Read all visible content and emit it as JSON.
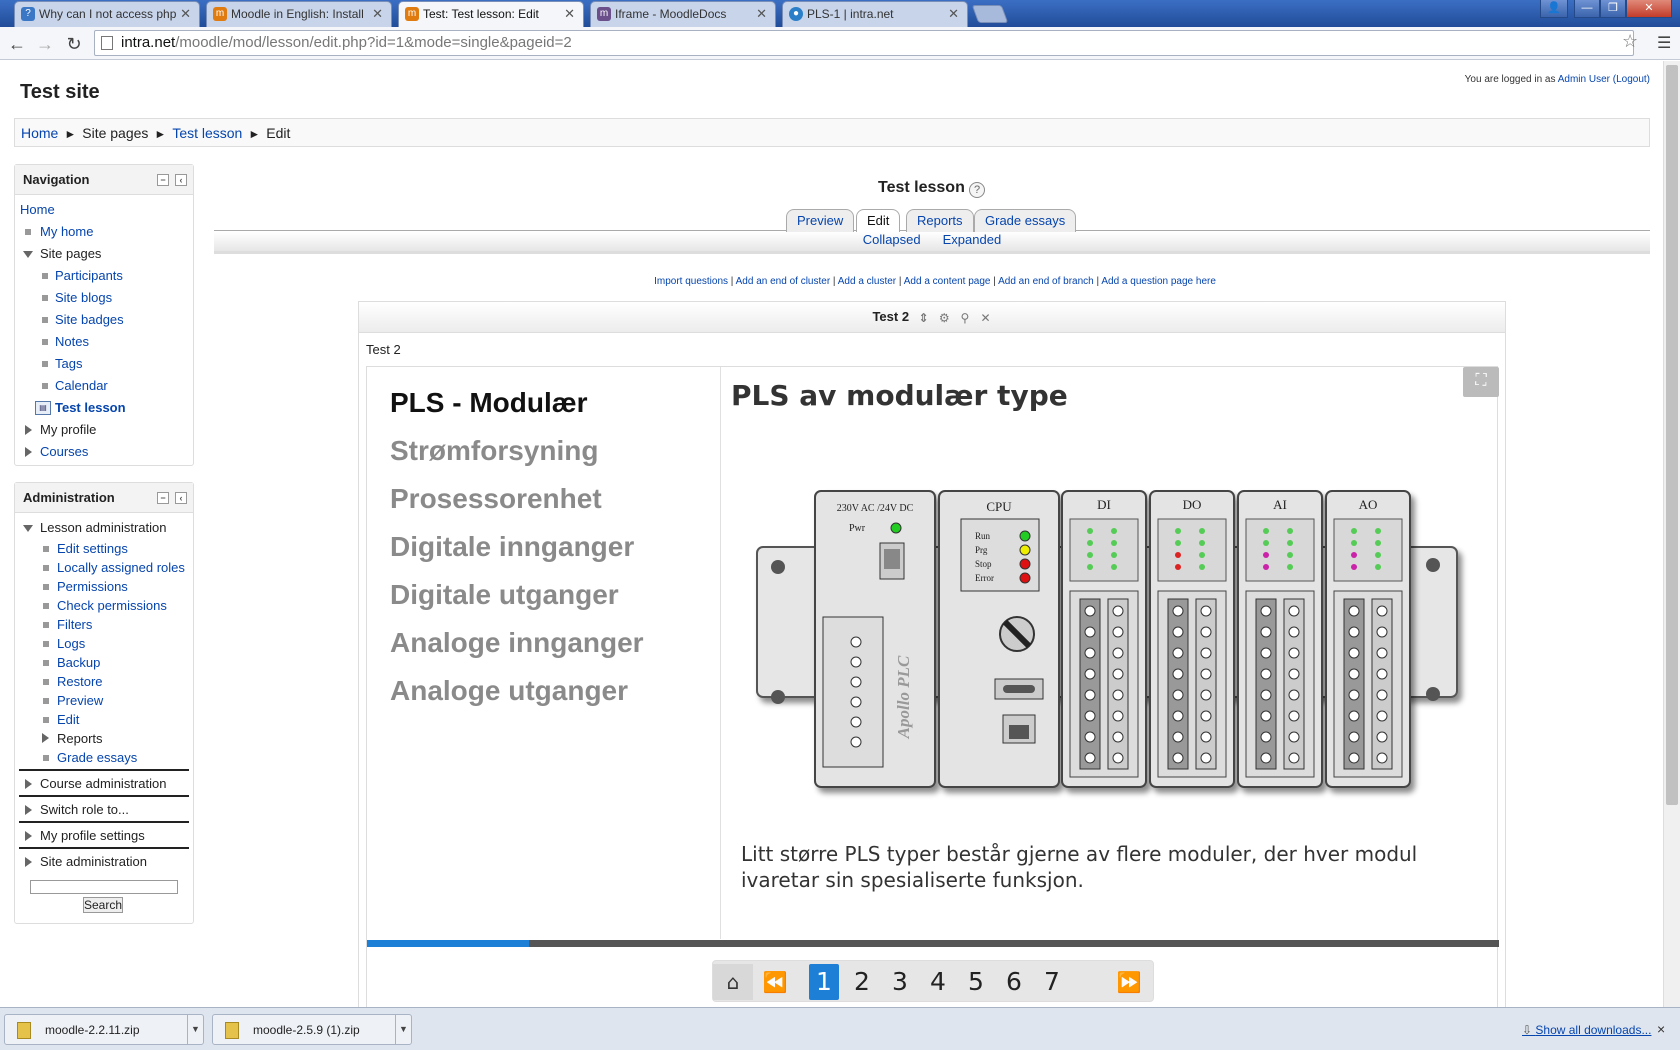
{
  "browser": {
    "tabs": [
      {
        "title": "Why can I not access php",
        "icon": "question-icon"
      },
      {
        "title": "Moodle in English: Install",
        "icon": "moodle-icon"
      },
      {
        "title": "Test: Test lesson: Edit",
        "icon": "moodle-icon"
      },
      {
        "title": "Iframe - MoodleDocs",
        "icon": "moodledocs-icon"
      },
      {
        "title": "PLS-1 | intra.net",
        "icon": "drupal-icon"
      }
    ],
    "active_tab": 2,
    "url_host": "intra.net",
    "url_path": "/moodle/mod/lesson/edit.php?id=1&mode=single&pageid=2"
  },
  "site": {
    "title": "Test site",
    "login_prefix": "You are logged in as ",
    "login_user": "Admin User",
    "logout": "(Logout)"
  },
  "breadcrumb": {
    "home": "Home",
    "site_pages": "Site pages",
    "lesson": "Test lesson",
    "edit": "Edit",
    "sep": "►"
  },
  "navigation": {
    "title": "Navigation",
    "home": "Home",
    "my_home": "My home",
    "site_pages": "Site pages",
    "items": [
      "Participants",
      "Site blogs",
      "Site badges",
      "Notes",
      "Tags",
      "Calendar"
    ],
    "current": "Test lesson",
    "my_profile": "My profile",
    "courses": "Courses"
  },
  "administration": {
    "title": "Administration",
    "lesson_admin": "Lesson administration",
    "items": [
      "Edit settings",
      "Locally assigned roles",
      "Permissions",
      "Check permissions",
      "Filters",
      "Logs",
      "Backup",
      "Restore",
      "Preview",
      "Edit"
    ],
    "reports": "Reports",
    "grade_essays": "Grade essays",
    "sections": [
      "Course administration",
      "Switch role to...",
      "My profile settings",
      "Site administration"
    ],
    "search_button": "Search"
  },
  "lesson": {
    "title": "Test lesson",
    "help": "?",
    "tabs": [
      "Preview",
      "Edit",
      "Reports",
      "Grade essays"
    ],
    "selected_tab": "Edit",
    "subtabs": [
      "Collapsed",
      "Expanded"
    ],
    "actions": [
      "Import questions",
      "Add an end of cluster",
      "Add a cluster",
      "Add a content page",
      "Add an end of branch",
      "Add a question page here"
    ],
    "action_sep": " | ",
    "page_header": "Test 2",
    "page_name": "Test 2"
  },
  "slide": {
    "menu": [
      "PLS - Modulær",
      "Strømforsyning",
      "Prosessorenhet",
      "Digitale innganger",
      "Digitale utganger",
      "Analoge innganger",
      "Analoge utganger"
    ],
    "current_menu": 0,
    "heading": "PLS av modulær type",
    "body": "Litt større PLS typer består gjerne av flere moduler, der hver modul ivaretar sin spesialiserte funksjon.",
    "progress_fraction": 0.143,
    "pages": [
      "1",
      "2",
      "3",
      "4",
      "5",
      "6",
      "7"
    ],
    "current_page": "1",
    "plc": {
      "psu_label": "230V AC /24V DC",
      "pwr": "Pwr",
      "brand": "Apollo PLC",
      "cpu": "CPU",
      "leds": [
        "Run",
        "Prg",
        "Stop",
        "Error"
      ],
      "modules": [
        "DI",
        "DO",
        "AI",
        "AO"
      ]
    }
  },
  "downloads": {
    "files": [
      "moodle-2.2.11.zip",
      "moodle-2.5.9 (1).zip"
    ],
    "show_all": "Show all downloads...",
    "close": "×"
  },
  "colors": {
    "link": "#0645ad",
    "accent": "#1d7fd6",
    "led_green": "#22cc22",
    "led_yellow": "#eeee00",
    "led_red": "#dd1111"
  }
}
